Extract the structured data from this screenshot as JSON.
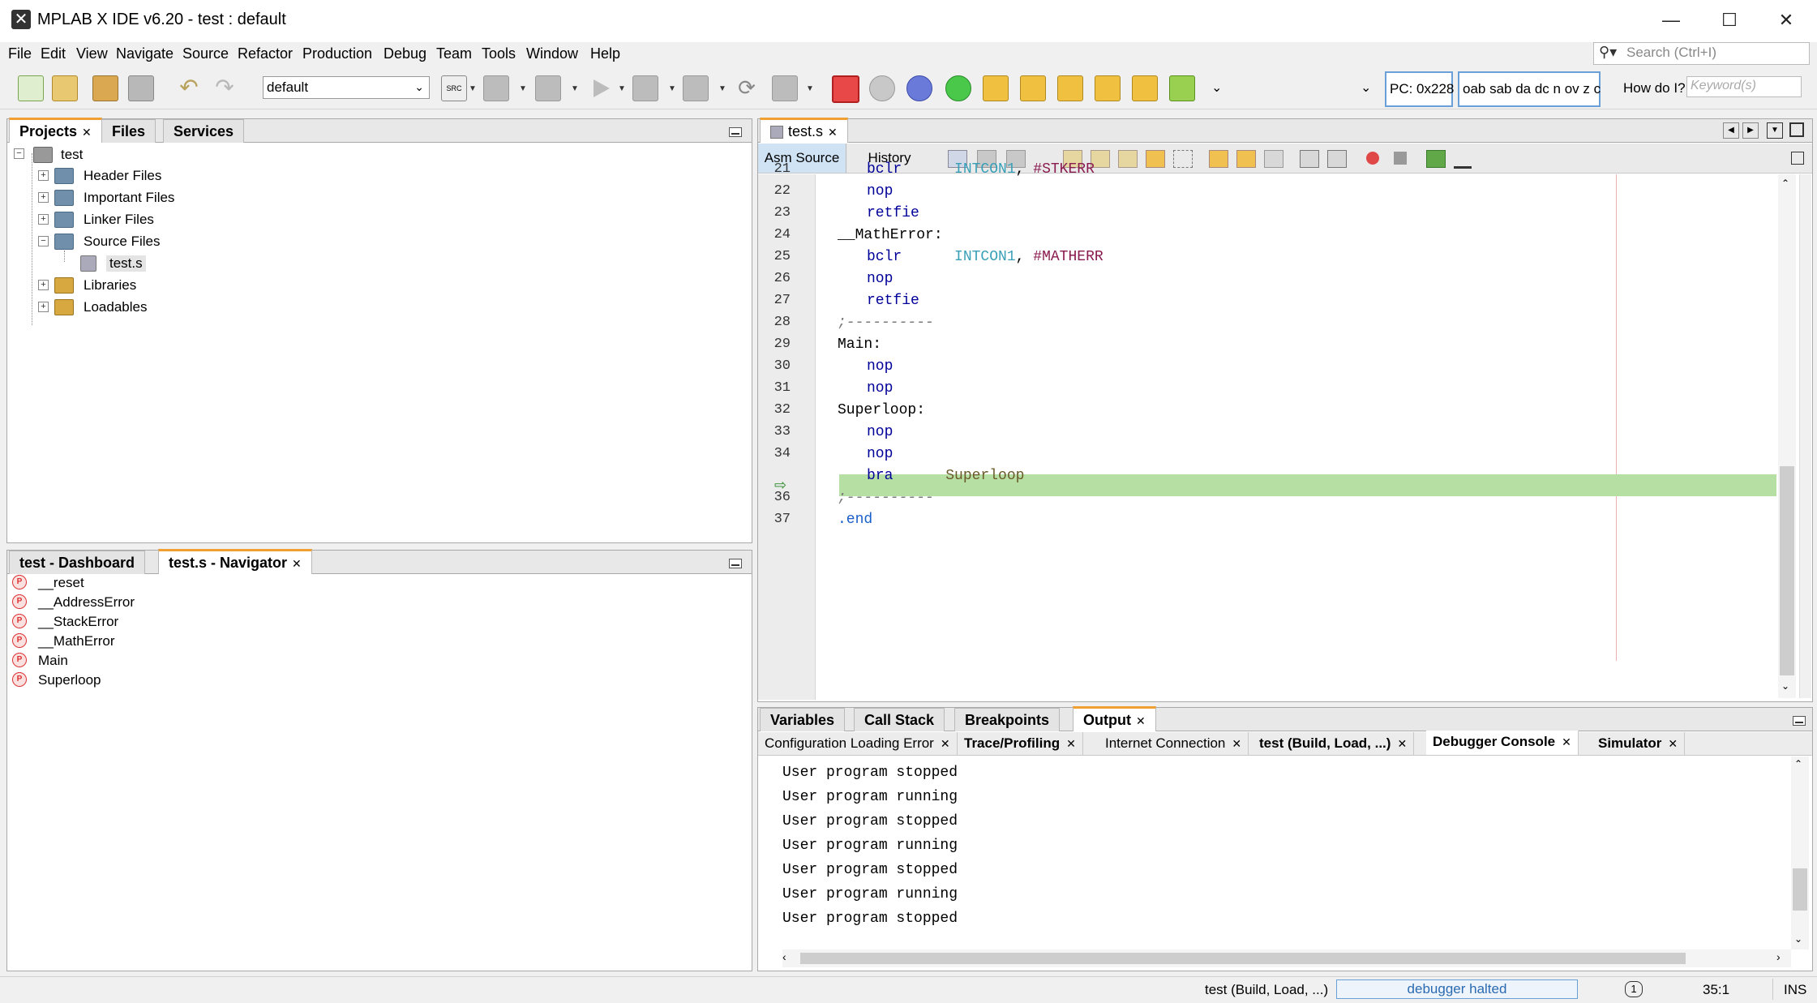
{
  "window": {
    "title": "MPLAB X IDE v6.20 - test : default",
    "minimize": "—",
    "maximize": "☐",
    "close": "✕"
  },
  "menu": [
    "File",
    "Edit",
    "View",
    "Navigate",
    "Source",
    "Refactor",
    "Production",
    "Debug",
    "Team",
    "Tools",
    "Window",
    "Help"
  ],
  "search": {
    "placeholder": "Search (Ctrl+I)"
  },
  "toolbar": {
    "config_value": "default",
    "pc": "PC: 0x228",
    "status_flags": "oab sab da dc n ov z c",
    "how_do_i": "How do I?",
    "keyword_placeholder": "Keyword(s)"
  },
  "projects_panel": {
    "tabs": [
      "Projects",
      "Files",
      "Services"
    ],
    "root": "test",
    "items": [
      "Header Files",
      "Important Files",
      "Linker Files",
      "Source Files",
      "Libraries",
      "Loadables"
    ],
    "source_file": "test.s"
  },
  "navigator_panel": {
    "tabs": [
      "test - Dashboard",
      "test.s - Navigator"
    ],
    "items": [
      "__reset",
      "__AddressError",
      "__StackError",
      "__MathError",
      "Main",
      "Superloop"
    ]
  },
  "editor": {
    "file_tab": "test.s",
    "subtabs": [
      "Asm Source",
      "History"
    ],
    "lines": [
      {
        "n": "21",
        "t": "    bclr      INTCON1, #STKERR"
      },
      {
        "n": "22",
        "t": "    nop"
      },
      {
        "n": "23",
        "t": "    retfie"
      },
      {
        "n": "24",
        "t": "__MathError:"
      },
      {
        "n": "25",
        "t": "    bclr      INTCON1, #MATHERR"
      },
      {
        "n": "26",
        "t": "    nop"
      },
      {
        "n": "27",
        "t": "    retfie"
      },
      {
        "n": "28",
        "t": ";----------"
      },
      {
        "n": "29",
        "t": "Main:"
      },
      {
        "n": "30",
        "t": "    nop"
      },
      {
        "n": "31",
        "t": "    nop"
      },
      {
        "n": "32",
        "t": "Superloop:"
      },
      {
        "n": "33",
        "t": "    nop"
      },
      {
        "n": "34",
        "t": "    nop"
      },
      {
        "n": "",
        "t": "    bra      Superloop"
      },
      {
        "n": "36",
        "t": ";----------"
      },
      {
        "n": "37",
        "t": ".end"
      }
    ]
  },
  "output_panel": {
    "tabs": [
      "Variables",
      "Call Stack",
      "Breakpoints",
      "Output"
    ],
    "subtabs": [
      "Configuration Loading Error",
      "Trace/Profiling",
      "Internet Connection",
      "test (Build, Load, ...)",
      "Debugger Console",
      "Simulator"
    ],
    "lines": [
      "User program stopped",
      "User program running",
      "User program stopped",
      "User program running",
      "User program stopped",
      "User program running",
      "User program stopped"
    ]
  },
  "statusbar": {
    "task": "test (Build, Load, ...)",
    "debugger": "debugger halted",
    "notifications": "1",
    "position": "35:1",
    "mode": "INS"
  }
}
